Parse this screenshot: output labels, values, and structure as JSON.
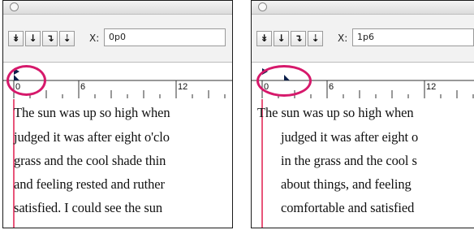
{
  "tab_buttons": [
    {
      "glyph": "↡",
      "icon": "left-justified-tab-icon"
    },
    {
      "glyph": "↓",
      "icon": "center-justified-tab-icon"
    },
    {
      "glyph": "↴",
      "icon": "right-justified-tab-icon"
    },
    {
      "glyph": "⇣",
      "icon": "align-to-decimal-tab-icon"
    }
  ],
  "panels": [
    {
      "x_label": "X:",
      "x_value": "0p0",
      "ruler_labels": [
        "0",
        "6",
        "12"
      ],
      "text_lines": [
        "The sun was up so high when",
        "judged it was after eight o'clo",
        "grass and the cool shade thin",
        "and feeling rested and ruther",
        "satisfied. I could see the sun "
      ]
    },
    {
      "x_label": "X:",
      "x_value": "1p6",
      "ruler_labels": [
        "0",
        "6",
        "12"
      ],
      "text_lines": [
        "The sun was up so high when",
        "judged it was after eight o",
        "in the grass and the cool s",
        "about things, and feeling",
        "comfortable and satisfied"
      ]
    }
  ],
  "colors": {
    "highlight": "#d6196b",
    "margin_guide": "#e8557a",
    "indent_marker": "#0b1f4a"
  }
}
